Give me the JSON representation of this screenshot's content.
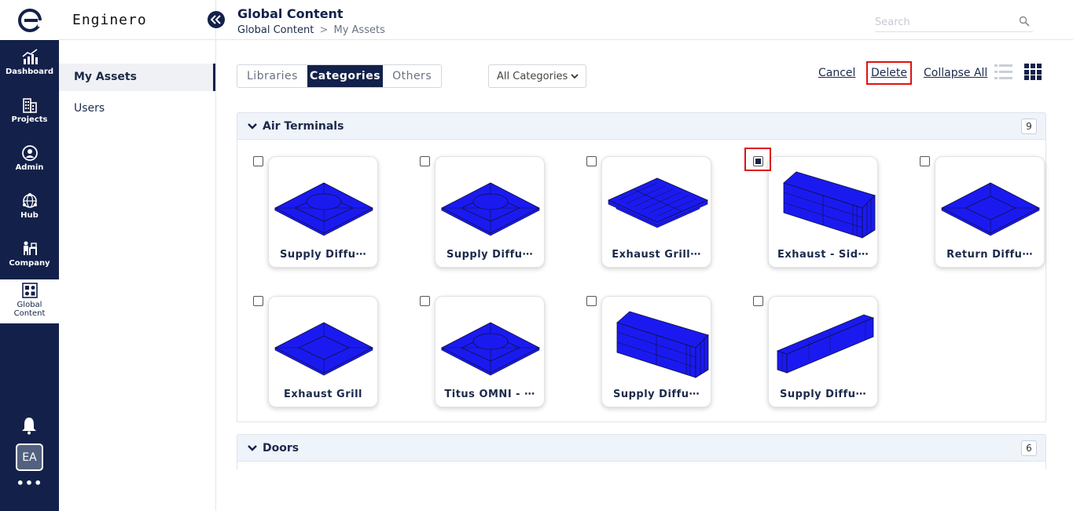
{
  "app": {
    "brand": "Enginero"
  },
  "rail": {
    "items": [
      {
        "label": "Dashboard",
        "icon": "dashboard-chart-icon"
      },
      {
        "label": "Projects",
        "icon": "building-icon"
      },
      {
        "label": "Admin",
        "icon": "admin-user-icon"
      },
      {
        "label": "Hub",
        "icon": "hub-globe-icon"
      },
      {
        "label": "Company",
        "icon": "company-desk-icon"
      },
      {
        "label": "Global",
        "label2": "Content",
        "icon": "global-content-icon"
      }
    ],
    "avatar_initials": "EA",
    "more_label": "•••"
  },
  "sidebar": {
    "items": [
      {
        "label": "My Assets",
        "active": true
      },
      {
        "label": "Users",
        "active": false
      }
    ]
  },
  "header": {
    "title": "Global Content",
    "breadcrumb_root": "Global Content",
    "breadcrumb_sep": ">",
    "breadcrumb_current": "My Assets",
    "search_placeholder": "Search"
  },
  "toolbar": {
    "tabs": [
      "Libraries",
      "Categories",
      "Others"
    ],
    "active_tab": "Categories",
    "category_filter": "All Categories",
    "cancel_label": "Cancel",
    "delete_label": "Delete",
    "collapse_label": "Collapse All"
  },
  "sections": [
    {
      "title": "Air Terminals",
      "count": "9",
      "assets": [
        {
          "name": "Supply Diffu⋯",
          "checked": false,
          "shape": "diffuser-round"
        },
        {
          "name": "Supply Diffu⋯",
          "checked": false,
          "shape": "diffuser-round"
        },
        {
          "name": "Exhaust Grill⋯",
          "checked": false,
          "shape": "grill-slotted"
        },
        {
          "name": "Exhaust - Sid⋯",
          "checked": true,
          "shape": "box-tall"
        },
        {
          "name": "Return Diffu⋯",
          "checked": false,
          "shape": "diffuser-square"
        },
        {
          "name": "Exhaust Grill",
          "checked": false,
          "shape": "diffuser-square"
        },
        {
          "name": "Titus OMNI - ⋯",
          "checked": false,
          "shape": "diffuser-round"
        },
        {
          "name": "Supply Diffu⋯",
          "checked": false,
          "shape": "box-tall"
        },
        {
          "name": "Supply Diffu⋯",
          "checked": false,
          "shape": "bar-linear"
        }
      ]
    },
    {
      "title": "Doors",
      "count": "6",
      "assets": []
    }
  ],
  "colors": {
    "rail_bg": "#13214a",
    "accent": "#13214a",
    "asset_blue": "#1a1af0",
    "highlight_red": "#e01212"
  }
}
